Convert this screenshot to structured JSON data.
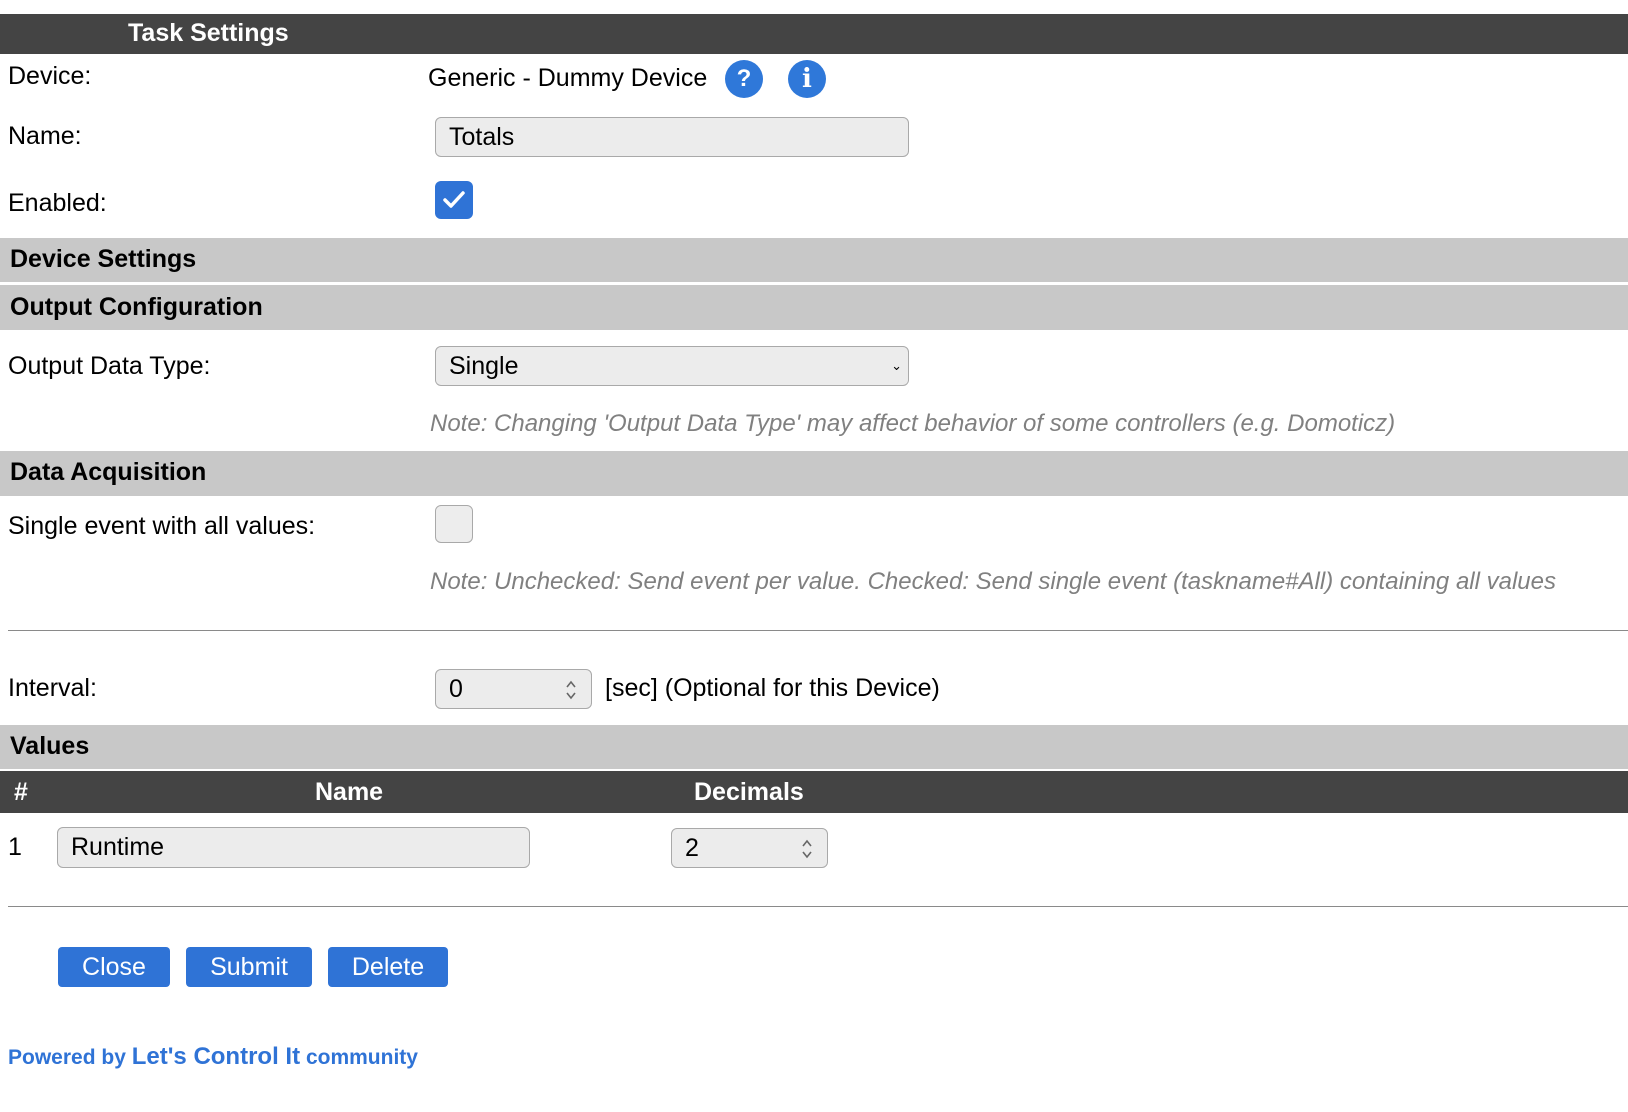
{
  "header": {
    "title": "Task Settings"
  },
  "device": {
    "label": "Device:",
    "value": "Generic - Dummy Device",
    "help_icon": "?",
    "info_icon": "i"
  },
  "name": {
    "label": "Name:",
    "value": "Totals"
  },
  "enabled": {
    "label": "Enabled:",
    "checked": true
  },
  "sections": {
    "device_settings": "Device Settings",
    "output_configuration": "Output Configuration",
    "data_acquisition": "Data Acquisition",
    "values": "Values"
  },
  "output_data_type": {
    "label": "Output Data Type:",
    "selected": "Single",
    "note": "Note: Changing 'Output Data Type' may affect behavior of some controllers (e.g. Domoticz)"
  },
  "single_event": {
    "label": "Single event with all values:",
    "checked": false,
    "note": "Note: Unchecked: Send event per value. Checked: Send single event (taskname#All) containing all values"
  },
  "interval": {
    "label": "Interval:",
    "value": "0",
    "suffix": "[sec] (Optional for this Device)"
  },
  "values_table": {
    "headers": {
      "index": "#",
      "name": "Name",
      "decimals": "Decimals"
    },
    "rows": [
      {
        "index": "1",
        "name": "Runtime",
        "decimals": "2"
      }
    ]
  },
  "buttons": {
    "close": "Close",
    "submit": "Submit",
    "delete": "Delete"
  },
  "footer": {
    "powered_by": "Powered by",
    "community": "Let's Control It",
    "community_suffix": "community"
  },
  "colors": {
    "accent": "#2f73d6",
    "header_bg": "#444444",
    "section_bg": "#c8c8c8"
  }
}
